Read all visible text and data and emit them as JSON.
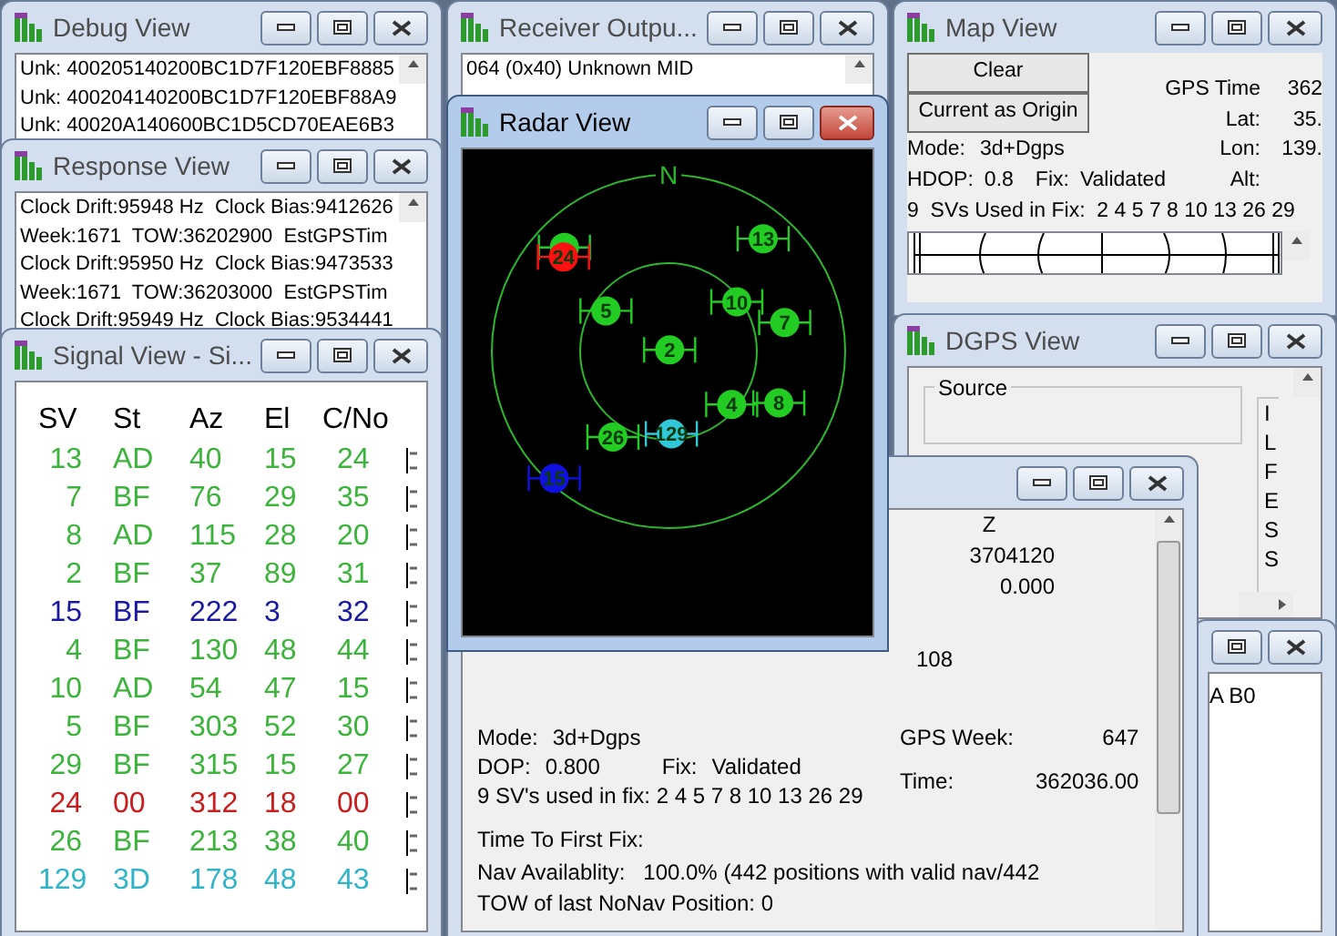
{
  "debug_view": {
    "title": "Debug View",
    "active": false,
    "lines": [
      "Unk: 400205140200BC1D7F120EBF8885",
      "Unk: 400204140200BC1D7F120EBF88A9",
      "Unk: 40020A140600BC1D5CD70EAE6B3"
    ]
  },
  "response_view": {
    "title": "Response View",
    "active": false,
    "lines": [
      "Clock Drift:95948 Hz  Clock Bias:9412626",
      "Week:1671  TOW:36202900  EstGPSTim",
      "Clock Drift:95950 Hz  Clock Bias:9473533",
      "Week:1671  TOW:36203000  EstGPSTim",
      "Clock Drift:95949 Hz  Clock Bias:9534441"
    ]
  },
  "signal_view": {
    "title": "Signal View - Si...",
    "active": false,
    "columns": [
      "SV",
      "St",
      "Az",
      "El",
      "C/No"
    ],
    "rows": [
      {
        "sv": "13",
        "st": "AD",
        "az": "40",
        "el": "15",
        "cno": "24",
        "color": "#3cb43c"
      },
      {
        "sv": "7",
        "st": "BF",
        "az": "76",
        "el": "29",
        "cno": "35",
        "color": "#3cb43c"
      },
      {
        "sv": "8",
        "st": "AD",
        "az": "115",
        "el": "28",
        "cno": "20",
        "color": "#3cb43c"
      },
      {
        "sv": "2",
        "st": "BF",
        "az": "37",
        "el": "89",
        "cno": "31",
        "color": "#3cb43c"
      },
      {
        "sv": "15",
        "st": "BF",
        "az": "222",
        "el": "3",
        "cno": "32",
        "color": "#1a1aa0"
      },
      {
        "sv": "4",
        "st": "BF",
        "az": "130",
        "el": "48",
        "cno": "44",
        "color": "#3cb43c"
      },
      {
        "sv": "10",
        "st": "AD",
        "az": "54",
        "el": "47",
        "cno": "15",
        "color": "#3cb43c"
      },
      {
        "sv": "5",
        "st": "BF",
        "az": "303",
        "el": "52",
        "cno": "30",
        "color": "#3cb43c"
      },
      {
        "sv": "29",
        "st": "BF",
        "az": "315",
        "el": "15",
        "cno": "27",
        "color": "#3cb43c"
      },
      {
        "sv": "24",
        "st": "00",
        "az": "312",
        "el": "18",
        "cno": "00",
        "color": "#c81e1e"
      },
      {
        "sv": "26",
        "st": "BF",
        "az": "213",
        "el": "38",
        "cno": "40",
        "color": "#3cb43c"
      },
      {
        "sv": "129",
        "st": "3D",
        "az": "178",
        "el": "48",
        "cno": "43",
        "color": "#30b4c8"
      }
    ]
  },
  "receiver_output": {
    "title": "Receiver Outpu...",
    "active": false,
    "lines": [
      "064 (0x40) Unknown MID"
    ]
  },
  "map_view": {
    "title": "Map View",
    "active": false,
    "buttons": [
      "Clear",
      "Current as Origin"
    ],
    "readouts": [
      {
        "label": "GPS Time",
        "value": "362"
      },
      {
        "label": "Lat:",
        "value": "35."
      },
      {
        "label": "Lon:",
        "value": "139."
      },
      {
        "label": "Alt:"
      }
    ],
    "mode_label": "Mode:",
    "mode": "3d+Dgps",
    "hdop_label": "HDOP:",
    "hdop": "0.8",
    "fix_label": "Fix:",
    "fix": "Validated",
    "svs_line": "9  SVs Used in Fix:  2 4 5 7 8 10 13 26 29"
  },
  "dgps_view": {
    "title": "DGPS View",
    "active": false,
    "source_label": "Source",
    "side_letters": [
      "I",
      "L",
      "F",
      "E",
      "S",
      "S"
    ]
  },
  "data_window": {
    "active": false,
    "text": "A B0"
  },
  "navigation_window": {
    "active": false,
    "z_header": "Z",
    "z_values": [
      "3704120",
      "0.000"
    ],
    "extra_value": "108",
    "mode_label": "Mode:",
    "mode": "3d+Dgps",
    "dop_label": "DOP:",
    "dop": "0.800",
    "fix_label": "Fix:",
    "fix": "Validated",
    "svs_line": "9 SV's used in fix: 2 4 5 7 8 10 13 26 29",
    "gps_week_label": "GPS Week:",
    "gps_week": "647",
    "time_label": "Time:",
    "time": "362036.00",
    "ttff_label": "Time To First Fix:",
    "nav_availability": "Nav Availablity:   100.0% (442 positions with valid nav/442",
    "tow_line": "TOW of last NoNav Position: 0"
  },
  "radar_view": {
    "title": "Radar View",
    "active": true,
    "north": "N",
    "satellites": [
      {
        "label": "13",
        "color": "#22cc22"
      },
      {
        "label": "7",
        "color": "#22cc22"
      },
      {
        "label": "8",
        "color": "#22cc22"
      },
      {
        "label": "2",
        "color": "#22cc22"
      },
      {
        "label": "15",
        "color": "#1010e0"
      },
      {
        "label": "4",
        "color": "#22cc22"
      },
      {
        "label": "10",
        "color": "#22cc22"
      },
      {
        "label": "5",
        "color": "#22cc22"
      },
      {
        "color": "#22cc22"
      },
      {
        "label": "24",
        "color": "#ff1010"
      },
      {
        "label": "26",
        "color": "#22cc22"
      },
      {
        "label": "129",
        "color": "#30c8d8"
      }
    ]
  }
}
